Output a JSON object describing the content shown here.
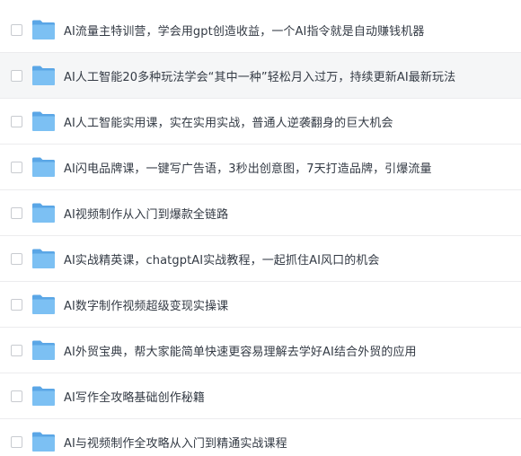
{
  "file_list": {
    "items": [
      {
        "label": "AI流量主特训营，学会用gpt创造收益，一个AI指令就是自动赚钱机器",
        "icon": "folder-icon",
        "highlighted": false
      },
      {
        "label": "AI人工智能20多种玩法学会“其中一种”轻松月入过万，持续更新AI最新玩法",
        "icon": "folder-icon",
        "highlighted": true
      },
      {
        "label": "AI人工智能实用课，实在实用实战，普通人逆袭翻身的巨大机会",
        "icon": "folder-icon",
        "highlighted": false
      },
      {
        "label": "AI闪电品牌课，一键写广告语，3秒出创意图，7天打造品牌，引爆流量",
        "icon": "folder-icon",
        "highlighted": false
      },
      {
        "label": "AI视频制作从入门到爆款全链路",
        "icon": "folder-icon",
        "highlighted": false
      },
      {
        "label": "AI实战精英课，chatgptAI实战教程，一起抓住AI风口的机会",
        "icon": "folder-icon",
        "highlighted": false
      },
      {
        "label": "AI数字制作视频超级变现实操课",
        "icon": "folder-icon",
        "highlighted": false
      },
      {
        "label": "AI外贸宝典，帮大家能简单快速更容易理解去学好AI结合外贸的应用",
        "icon": "folder-icon",
        "highlighted": false
      },
      {
        "label": "AI写作全攻略基础创作秘籍",
        "icon": "folder-icon",
        "highlighted": false
      },
      {
        "label": "AI与视频制作全攻略从入门到精通实战课程",
        "icon": "folder-icon",
        "highlighted": false
      }
    ]
  },
  "colors": {
    "folder_body": "#7cc0f3",
    "folder_back": "#5aa6e6",
    "highlight_bg": "#f5f6f7",
    "text": "#333a44",
    "divider": "#ececee"
  }
}
